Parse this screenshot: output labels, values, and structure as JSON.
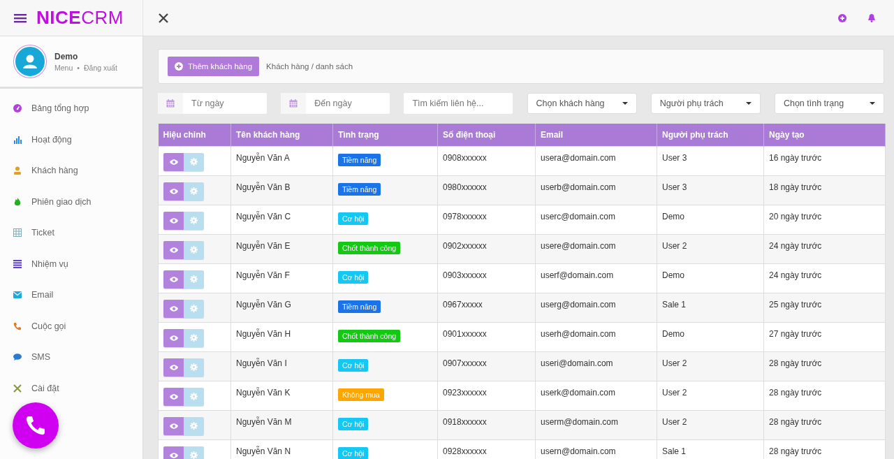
{
  "topbar": {
    "logo": "**NICE**CRM"
  },
  "profile": {
    "name": "Demo",
    "links": [
      "Menu",
      "Đăng xuất"
    ],
    "separator": "•"
  },
  "sidebar": {
    "items": [
      {
        "label": "Bảng tổng hợp"
      },
      {
        "label": "Hoạt động"
      },
      {
        "label": "Khách hàng"
      },
      {
        "label": "Phiên giao dịch"
      },
      {
        "label": "Ticket"
      },
      {
        "label": "Nhiệm vụ"
      },
      {
        "label": "Email"
      },
      {
        "label": "Cuộc gọi"
      },
      {
        "label": "SMS"
      },
      {
        "label": "Cài đặt"
      }
    ]
  },
  "toolbar": {
    "add_button": "Thêm khách hàng",
    "breadcrumb": "Khách hàng / danh sách"
  },
  "filters": {
    "from_date": {
      "placeholder": "Từ ngày"
    },
    "to_date": {
      "placeholder": "Đến ngày"
    },
    "search": {
      "placeholder": "Tìm kiếm liên hệ..."
    },
    "dropdowns": [
      "Chọn khách hàng",
      "Người phụ trách",
      "Chọn tình trạng"
    ]
  },
  "table": {
    "columns": [
      "Hiệu chỉnh",
      "Tên khách hàng",
      "Tình trạng",
      "Số điện thoại",
      "Email",
      "Người phụ trách",
      "Ngày tạo"
    ],
    "rows": [
      {
        "name": "Nguyễn Văn A",
        "status": {
          "label": "Tiềm năng",
          "color": "#1a73e8"
        },
        "phone": "0908xxxxxx",
        "email": "usera@domain.com",
        "owner": "User 3",
        "created": "16 ngày trước"
      },
      {
        "name": "Nguyễn Văn B",
        "status": {
          "label": "Tiềm năng",
          "color": "#1a73e8"
        },
        "phone": "0980xxxxxx",
        "email": "userb@domain.com",
        "owner": "User 3",
        "created": "18 ngày trước"
      },
      {
        "name": "Nguyễn Văn C",
        "status": {
          "label": "Cơ hội",
          "color": "#14c8f5"
        },
        "phone": "0978xxxxxx",
        "email": "userc@domain.com",
        "owner": "Demo",
        "created": "20 ngày trước"
      },
      {
        "name": "Nguyễn Văn E",
        "status": {
          "label": "Chốt thành công",
          "color": "#14c814"
        },
        "phone": "0902xxxxxx",
        "email": "usere@domain.com",
        "owner": "User 2",
        "created": "24 ngày trước"
      },
      {
        "name": "Nguyễn Văn F",
        "status": {
          "label": "Cơ hội",
          "color": "#14c8f5"
        },
        "phone": "0903xxxxxx",
        "email": "userf@domain.com",
        "owner": "Demo",
        "created": "24 ngày trước"
      },
      {
        "name": "Nguyễn Văn G",
        "status": {
          "label": "Tiềm năng",
          "color": "#1a73e8"
        },
        "phone": "0967xxxxx",
        "email": "userg@domain.com",
        "owner": "Sale 1",
        "created": "25 ngày trước"
      },
      {
        "name": "Nguyễn Văn H",
        "status": {
          "label": "Chốt thành công",
          "color": "#14c814"
        },
        "phone": "0901xxxxxx",
        "email": "userh@domain.com",
        "owner": "Demo",
        "created": "27 ngày trước"
      },
      {
        "name": "Nguyễn Văn I",
        "status": {
          "label": "Cơ hội",
          "color": "#14c8f5"
        },
        "phone": "0907xxxxxx",
        "email": "useri@domain.com",
        "owner": "User 2",
        "created": "28 ngày trước"
      },
      {
        "name": "Nguyễn Văn K",
        "status": {
          "label": "Không mua",
          "color": "#ffa500"
        },
        "phone": "0923xxxxxx",
        "email": "userk@domain.com",
        "owner": "User 2",
        "created": "28 ngày trước"
      },
      {
        "name": "Nguyễn Văn M",
        "status": {
          "label": "Cơ hội",
          "color": "#14c8f5"
        },
        "phone": "0918xxxxxx",
        "email": "userm@domain.com",
        "owner": "User 2",
        "created": "28 ngày trước"
      },
      {
        "name": "Nguyễn Văn N",
        "status": {
          "label": "Cơ hội",
          "color": "#14c8f5"
        },
        "phone": "0928xxxxxx",
        "email": "usern@domain.com",
        "owner": "Sale 1",
        "created": "28 ngày trước"
      }
    ]
  }
}
